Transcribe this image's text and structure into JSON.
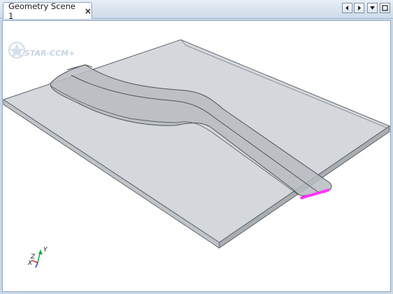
{
  "tab": {
    "title": "Geometry Scene 1",
    "close_glyph": "×"
  },
  "tab_controls": [
    "scroll-left",
    "scroll-right",
    "tab-list-dropdown",
    "maximize"
  ],
  "scene": {
    "watermark": "STAR-CCM+",
    "axes": {
      "x": "X",
      "y": "Y",
      "z": "Z"
    },
    "highlight_color": "#ff33ff",
    "plate_color": "#d3d7db",
    "body_color": "#b9bec3"
  }
}
